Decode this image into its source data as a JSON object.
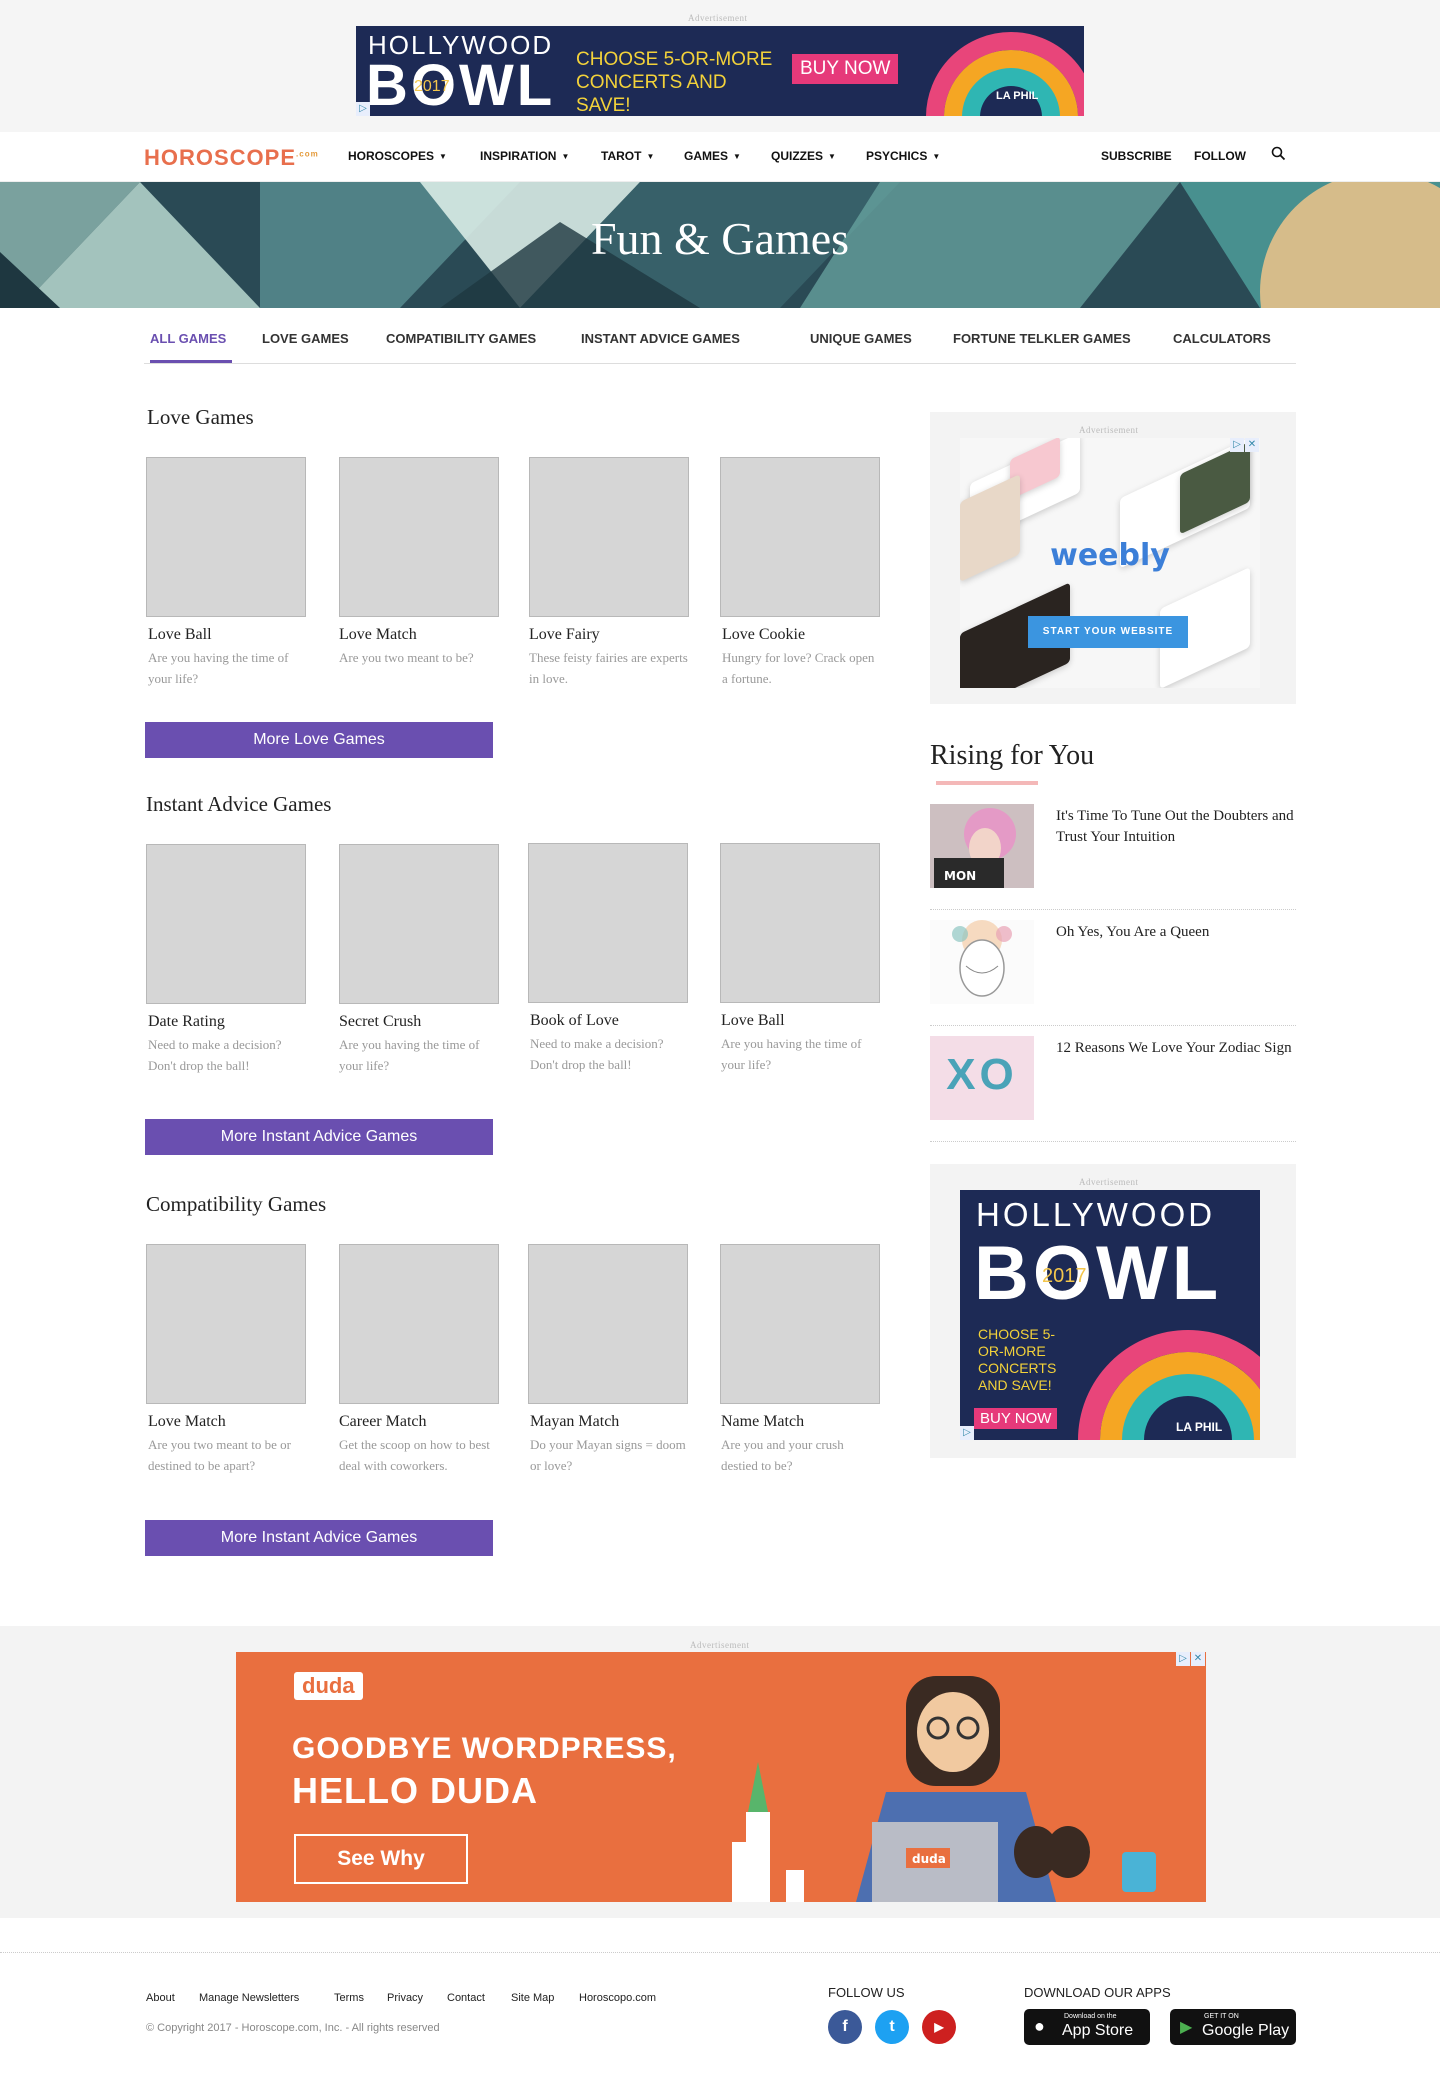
{
  "ads": {
    "label": "Advertisement",
    "hollywood_bowl": {
      "line1": "HOLLYWOOD",
      "line2": "BOWL",
      "year": "2017",
      "cta": "CHOOSE 5-OR-MORE CONCERTS AND SAVE!",
      "buy": "BUY NOW",
      "sponsor": "LA PHIL"
    },
    "weebly": {
      "logo": "weebly",
      "button": "START YOUR WEBSITE"
    },
    "duda": {
      "logo": "duda",
      "headline1": "GOODBYE WORDPRESS,",
      "headline2": "HELLO DUDA",
      "button": "See Why",
      "laptop_label": "duda"
    }
  },
  "nav": {
    "logo": "HOROSCOPE",
    "logo_suffix": ".com",
    "items": [
      "HOROSCOPES",
      "INSPIRATION",
      "TAROT",
      "GAMES",
      "QUIZZES",
      "PSYCHICS"
    ],
    "subscribe": "SUBSCRIBE",
    "follow": "FOLLOW"
  },
  "hero": {
    "title": "Fun & Games"
  },
  "tabs": [
    "ALL GAMES",
    "LOVE GAMES",
    "COMPATIBILITY GAMES",
    "INSTANT ADVICE GAMES",
    "UNIQUE GAMES",
    "FORTUNE TELKLER GAMES",
    "CALCULATORS"
  ],
  "sections": [
    {
      "title": "Love Games",
      "button": "More Love Games",
      "cards": [
        {
          "name": "Love Ball",
          "desc": "Are you having the time of your life?"
        },
        {
          "name": "Love Match",
          "desc": "Are you two meant to be?"
        },
        {
          "name": "Love Fairy",
          "desc": "These feisty fairies are experts in love."
        },
        {
          "name": "Love Cookie",
          "desc": "Hungry for love? Crack open a fortune."
        }
      ]
    },
    {
      "title": "Instant Advice Games",
      "button": "More Instant Advice Games",
      "cards": [
        {
          "name": "Date Rating",
          "desc": "Need to make a decision? Don't drop the ball!"
        },
        {
          "name": "Secret Crush",
          "desc": "Are you having the time of your life?"
        },
        {
          "name": "Book of Love",
          "desc": "Need to make a decision? Don't drop the ball!"
        },
        {
          "name": "Love Ball",
          "desc": "Are you having the time of your life?"
        }
      ]
    },
    {
      "title": "Compatibility  Games",
      "button": "More Instant Advice Games",
      "cards": [
        {
          "name": "Love Match",
          "desc": "Are you two meant to be or destined to be apart?"
        },
        {
          "name": "Career Match",
          "desc": "Get the scoop on how to best deal with coworkers."
        },
        {
          "name": "Mayan Match",
          "desc": "Do your Mayan signs = doom or love?"
        },
        {
          "name": "Name Match",
          "desc": "Are you and your crush destied to be?"
        }
      ]
    }
  ],
  "rising": {
    "title": "Rising for You",
    "items": [
      {
        "text": "It's Time To Tune Out the Doubters and Trust Your Intuition"
      },
      {
        "text": "Oh Yes, You Are a Queen"
      },
      {
        "text": "12 Reasons We Love Your Zodiac Sign"
      }
    ],
    "thumb3_text": "XO"
  },
  "footer": {
    "links": [
      "About",
      "Manage Newsletters",
      "Terms",
      "Privacy",
      "Contact",
      "Site Map",
      "Horoscopo.com"
    ],
    "copyright": "© Copyright 2017 - Horoscope.com, Inc. - All rights reserved",
    "follow_heading": "FOLLOW US",
    "apps_heading": "DOWNLOAD OUR APPS",
    "social": [
      {
        "icon": "facebook-icon",
        "glyph": "f",
        "color": "#3b5998"
      },
      {
        "icon": "twitter-icon",
        "glyph": "t",
        "color": "#1da1f2"
      },
      {
        "icon": "youtube-icon",
        "glyph": "▶",
        "color": "#cd201f"
      }
    ],
    "appstore_small": "Download on the",
    "appstore_big": "App Store",
    "googleplay_small": "GET IT ON",
    "googleplay_big": "Google Play"
  },
  "colors": {
    "accent": "#6a4fb0",
    "hero_bg": "#2a4a55",
    "duda_bg": "#e96f3f",
    "rising_underline": "#f4b8b8"
  }
}
